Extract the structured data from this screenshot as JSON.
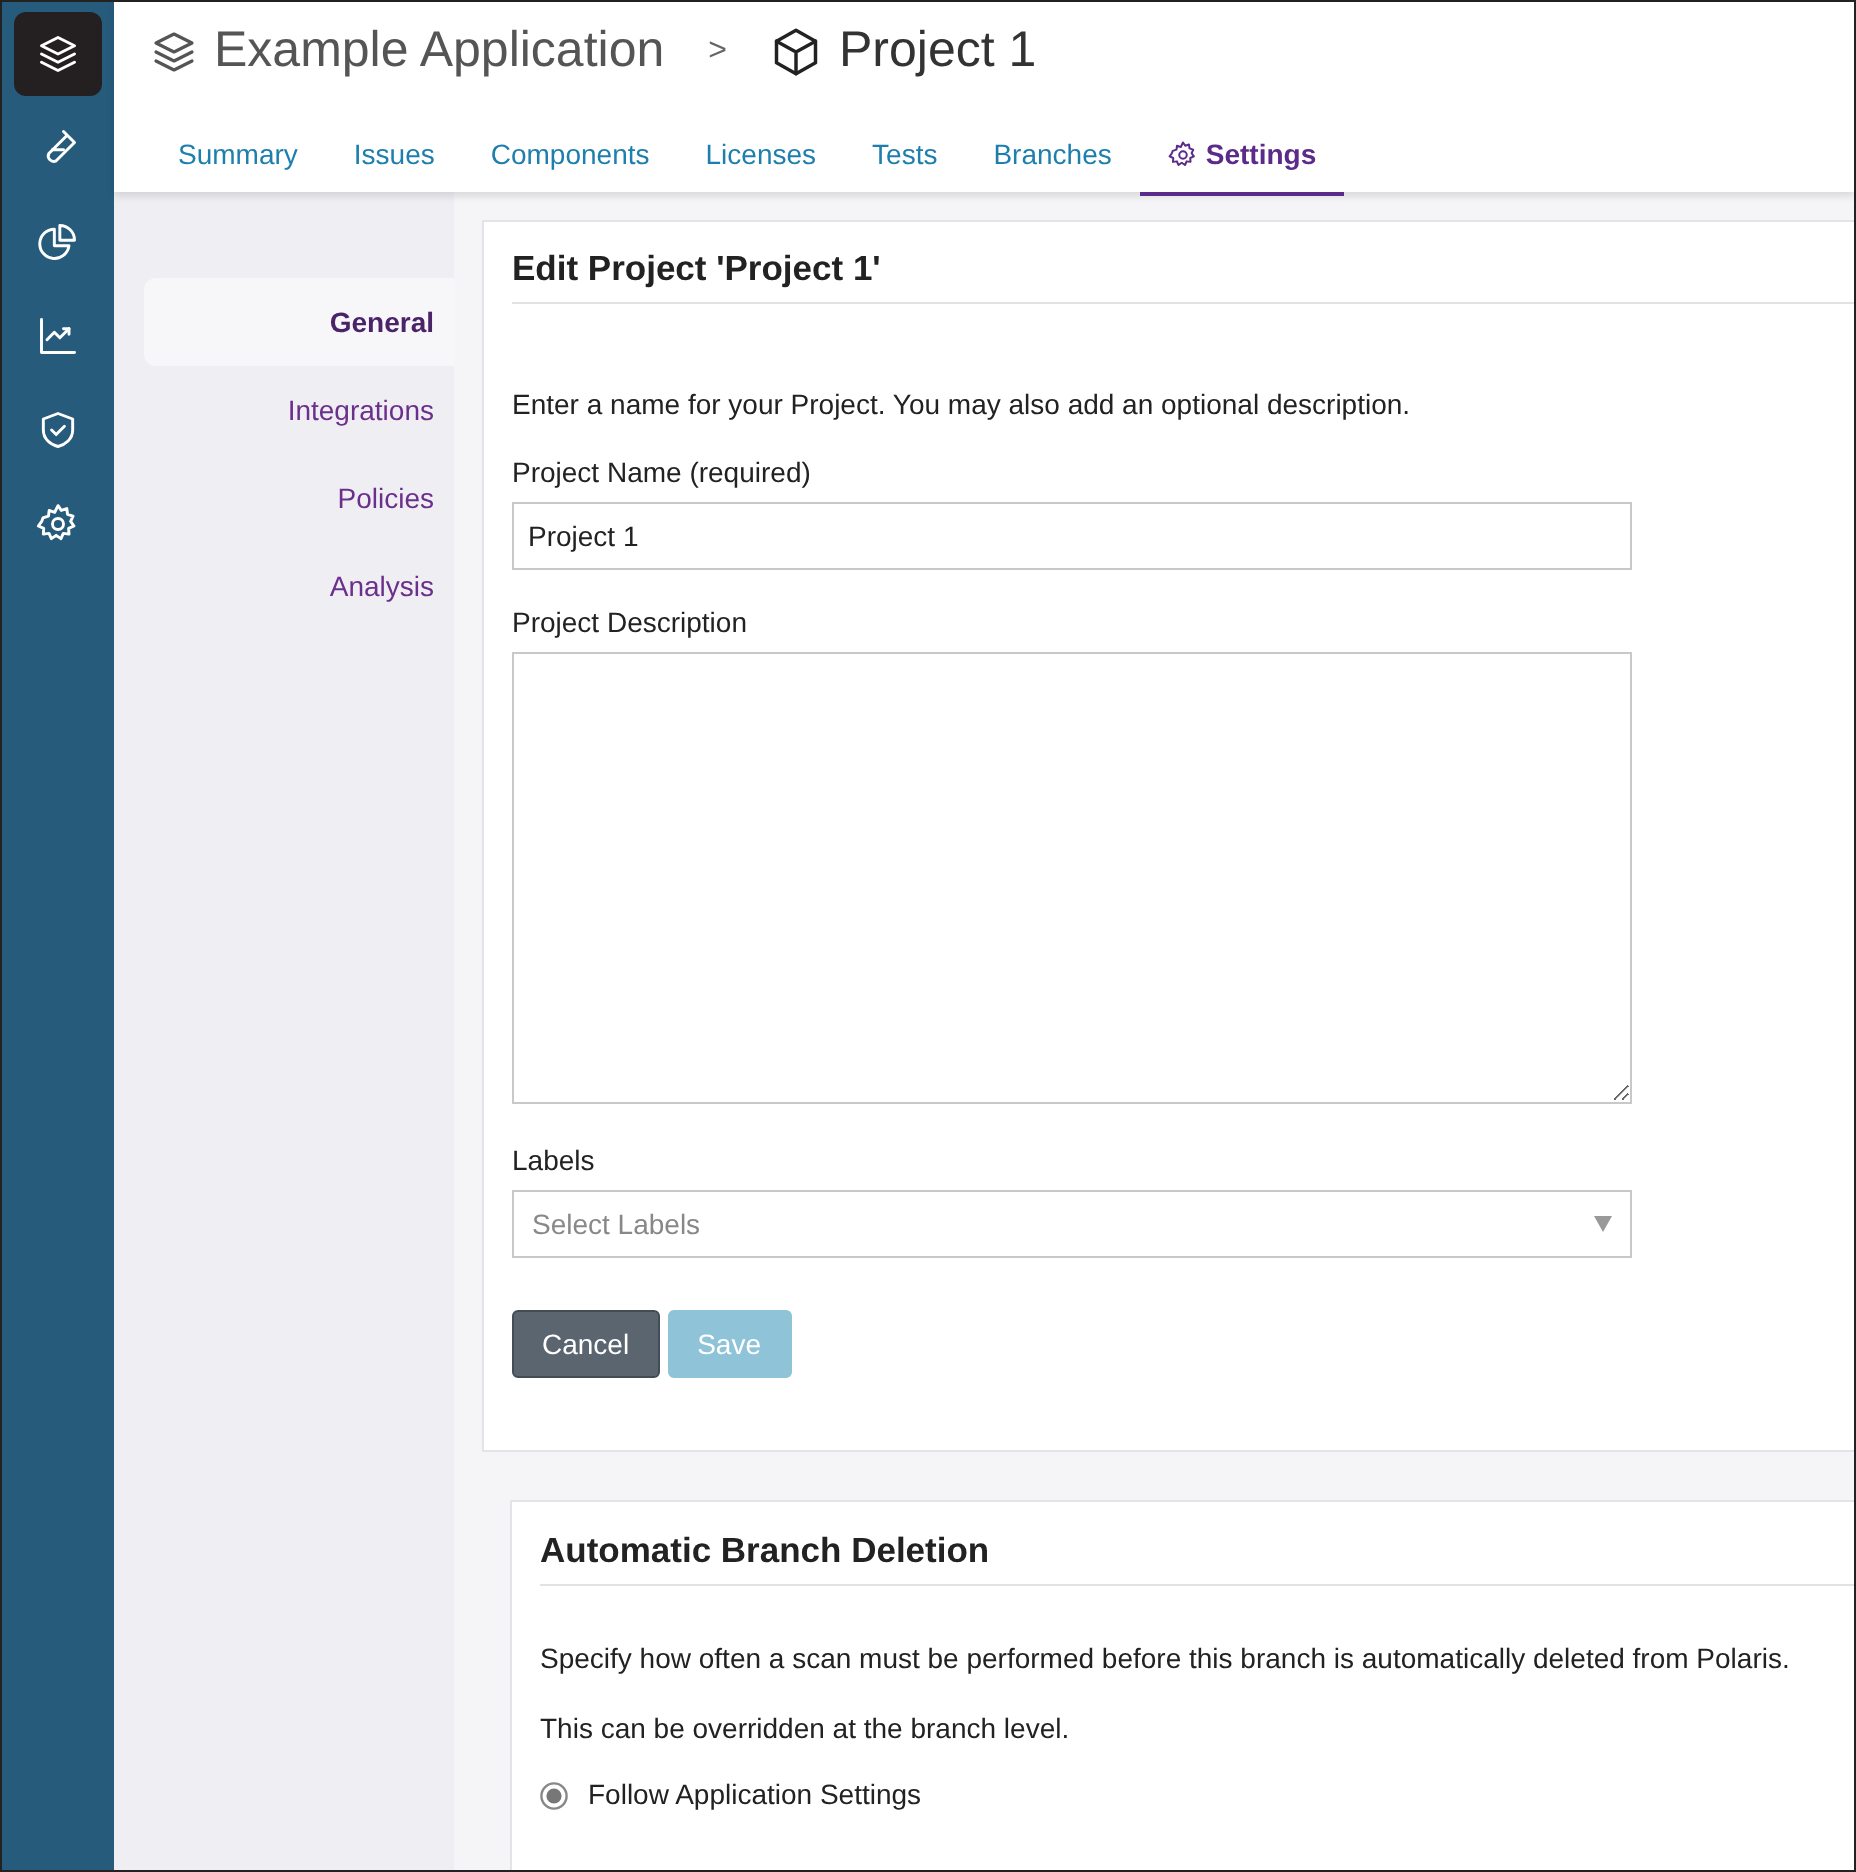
{
  "rail": [
    {
      "kind": "layers",
      "selected": true
    },
    {
      "kind": "flask",
      "selected": false
    },
    {
      "kind": "pie",
      "selected": false
    },
    {
      "kind": "trend",
      "selected": false
    },
    {
      "kind": "shield",
      "selected": false
    },
    {
      "kind": "gear",
      "selected": false
    }
  ],
  "breadcrumb": {
    "application": "Example Application",
    "separator": ">",
    "project": "Project 1"
  },
  "tabs": [
    {
      "label": "Summary",
      "selected": false,
      "kind": "plain"
    },
    {
      "label": "Issues",
      "selected": false,
      "kind": "plain"
    },
    {
      "label": "Components",
      "selected": false,
      "kind": "plain"
    },
    {
      "label": "Licenses",
      "selected": false,
      "kind": "plain"
    },
    {
      "label": "Tests",
      "selected": false,
      "kind": "plain"
    },
    {
      "label": "Branches",
      "selected": false,
      "kind": "plain"
    },
    {
      "label": "Settings",
      "selected": true,
      "kind": "settings"
    }
  ],
  "settings_nav": [
    {
      "label": "General",
      "selected": true
    },
    {
      "label": "Integrations",
      "selected": false
    },
    {
      "label": "Policies",
      "selected": false
    },
    {
      "label": "Analysis",
      "selected": false
    }
  ],
  "edit_card": {
    "title": "Edit Project 'Project 1'",
    "intro": "Enter a name for your Project. You may also add an optional description.",
    "name_label": "Project Name (required)",
    "name_value": "Project 1",
    "description_label": "Project Description",
    "labels_label": "Labels",
    "labels_placeholder": "Select Labels",
    "buttons": [
      {
        "label": "Cancel",
        "disabled": false
      },
      {
        "label": "Save",
        "disabled": true
      }
    ]
  },
  "branch_card": {
    "title": "Automatic Branch Deletion",
    "paragraphs": [
      "Specify how often a scan must be performed before this branch is automatically deleted from Polaris.",
      "This can be overridden at the branch level."
    ],
    "options": [
      {
        "label": "Follow Application Settings",
        "selected": true
      }
    ]
  }
}
